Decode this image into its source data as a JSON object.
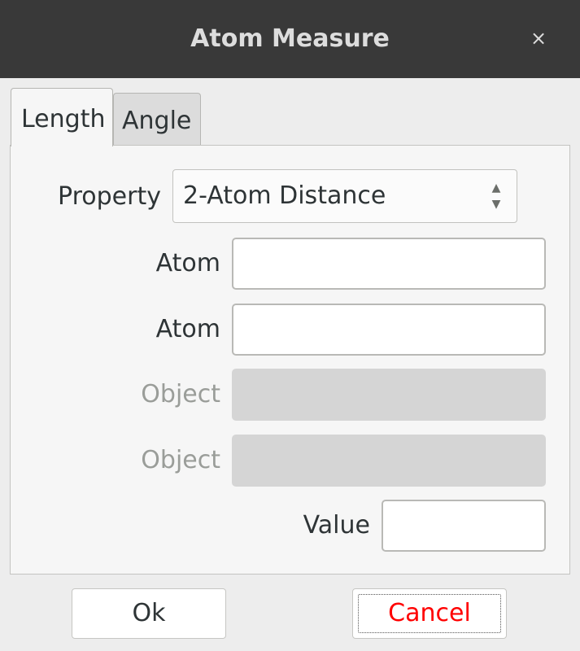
{
  "window": {
    "title": "Atom Measure",
    "close_glyph": "×"
  },
  "tabs": [
    {
      "label": "Length"
    },
    {
      "label": "Angle"
    }
  ],
  "form": {
    "property_label": "Property",
    "property_value": "2-Atom Distance",
    "atom1_label": "Atom",
    "atom1_value": "",
    "atom2_label": "Atom",
    "atom2_value": "",
    "object1_label": "Object",
    "object2_label": "Object",
    "value_label": "Value",
    "value_value": ""
  },
  "buttons": {
    "ok": "Ok",
    "cancel": "Cancel"
  },
  "colors": {
    "titlebar": "#393939",
    "cancel_text": "#ff0000"
  }
}
